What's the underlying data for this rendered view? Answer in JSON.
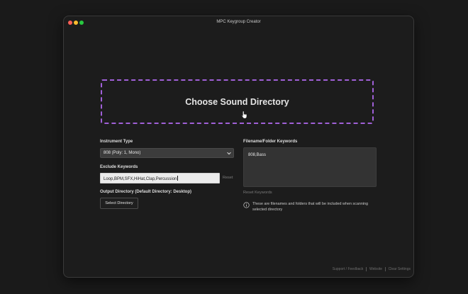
{
  "window": {
    "title": "MPC Keygroup Creator"
  },
  "dropzone": {
    "label": "Choose Sound Directory"
  },
  "instrument_type": {
    "label": "Instrument Type",
    "selected": "808 (Poly: 1, Mono)"
  },
  "exclude_keywords": {
    "label": "Exclude Keywords",
    "value": "Loop,BPM,SFX,HiHat,Clap,Percussion",
    "reset_label": "Reset"
  },
  "output_directory": {
    "label": "Output Directory (Default Directory: Desktop)",
    "button_label": "Select Directory"
  },
  "filename_keywords": {
    "label": "Filename/Folder Keywords",
    "value": "808,Bass",
    "reset_label": "Reset Keywords",
    "info_text": "These are filenames and folders that will be included when scanning selected directory",
    "info_icon": "info-icon"
  },
  "footer": {
    "links": [
      "Support / Feedback",
      "Website",
      "Clear Settings"
    ]
  },
  "colors": {
    "accent_dash": "#a060d8",
    "background": "#1c1c1c",
    "close": "#ff5f57",
    "minimize": "#febc2e",
    "maximize": "#28c840"
  }
}
